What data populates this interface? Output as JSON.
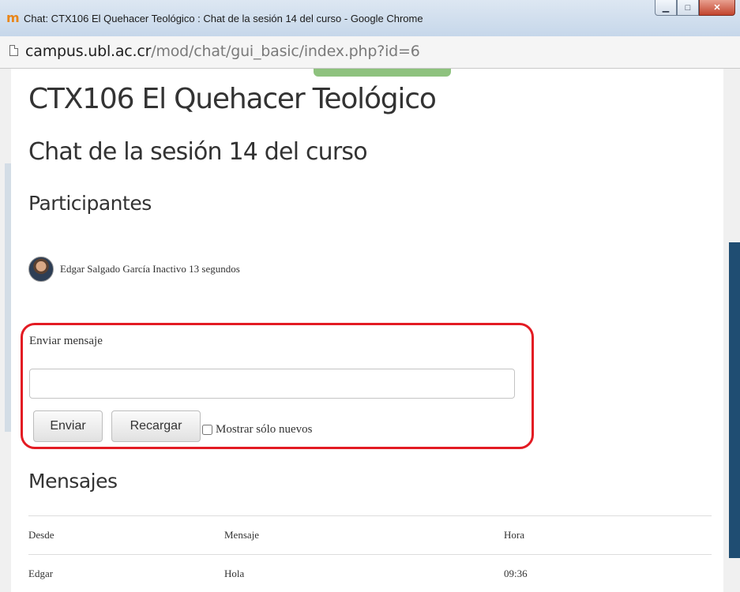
{
  "window": {
    "title": "Chat: CTX106 El Quehacer Teológico : Chat de la sesión 14 del curso - Google Chrome",
    "icon": "moodle-icon",
    "controls": {
      "minimize": "▁",
      "maximize": "□",
      "close": "✕"
    }
  },
  "address": {
    "host": "campus.ubl.ac.cr",
    "path": "/mod/chat/gui_basic/index.php?id=6"
  },
  "page": {
    "course_title": "CTX106 El Quehacer Teológico",
    "chat_title": "Chat de la sesión 14 del curso",
    "participants_heading": "Participantes",
    "participants": [
      {
        "name": "Edgar Salgado García Inactivo 13 segundos"
      }
    ],
    "send_form": {
      "label": "Enviar mensaje",
      "input_value": "",
      "send_button": "Enviar",
      "reload_button": "Recargar",
      "only_new_label": "Mostrar sólo nuevos",
      "only_new_checked": false
    },
    "messages_heading": "Mensajes",
    "messages_table": {
      "headers": [
        "Desde",
        "Mensaje",
        "Hora"
      ],
      "rows": [
        {
          "from": "Edgar",
          "message": "Hola",
          "time": "09:36"
        }
      ]
    }
  },
  "colors": {
    "highlight_border": "#e31b23",
    "right_panel": "#1f4d72",
    "top_tab": "#8ec27e"
  }
}
